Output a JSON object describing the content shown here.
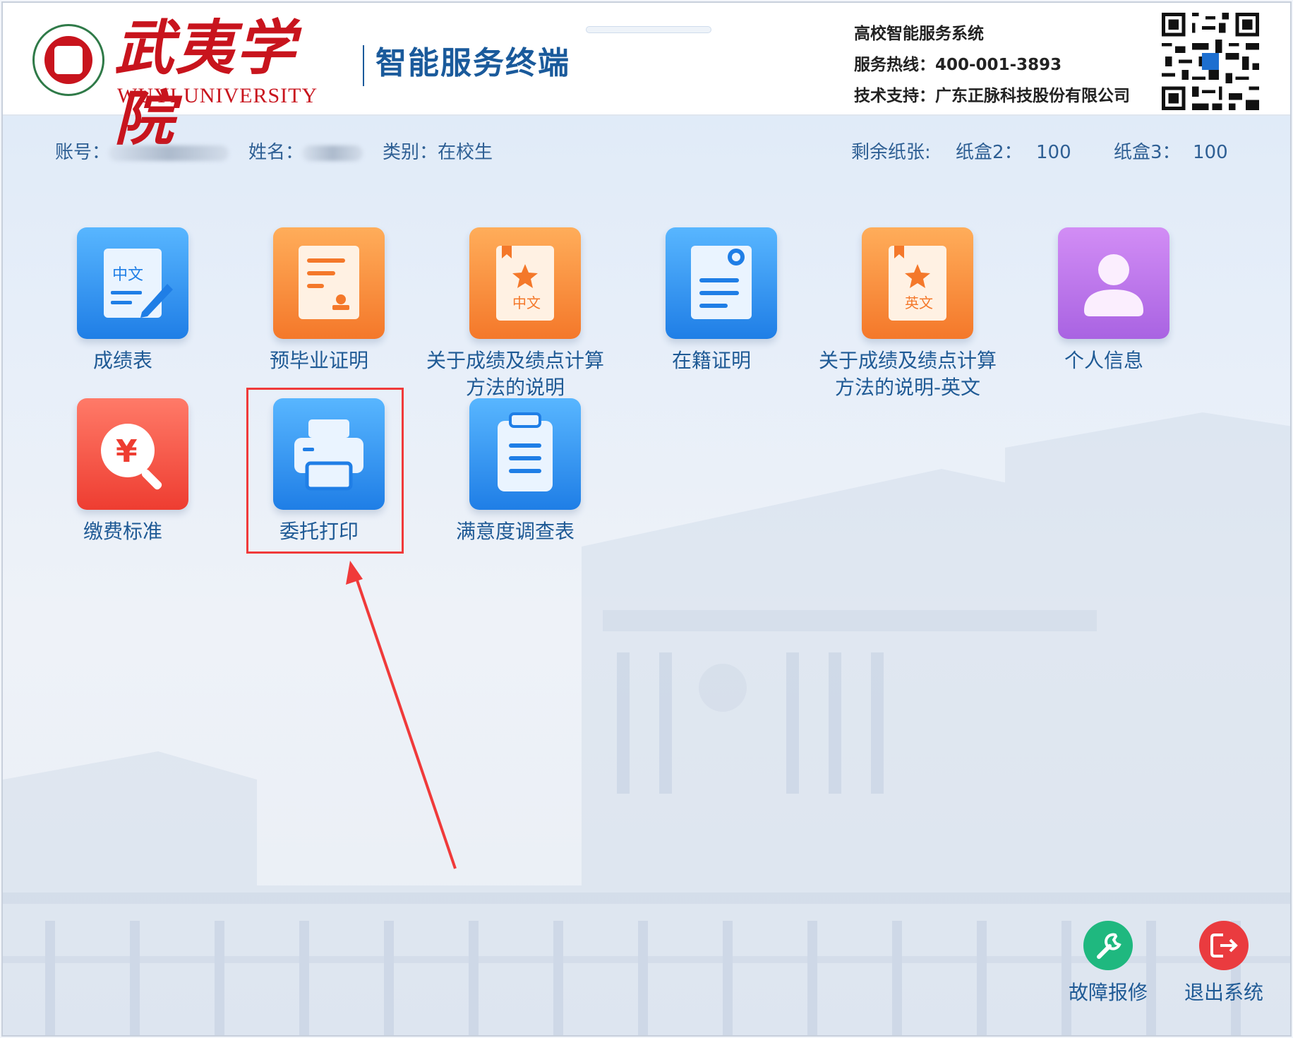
{
  "header": {
    "logo_text_cn": "武夷学院",
    "logo_text_en": "WUYI  UNIVERSITY",
    "terminal_title": "智能服务终端",
    "system_name": "高校智能服务系统",
    "hotline": "服务热线：400-001-3893",
    "support": "技术支持：广东正脉科技股份有限公司"
  },
  "user": {
    "account_label": "账号：",
    "name_label": "姓名：",
    "category_label": "类别：在校生"
  },
  "paper": {
    "remaining_label": "剩余纸张:",
    "tray2_label": "纸盒2：",
    "tray2_value": "100",
    "tray3_label": "纸盒3：",
    "tray3_value": "100"
  },
  "tiles": [
    {
      "label": "成绩表",
      "icon": "transcript-icon",
      "color": "blue"
    },
    {
      "label": "预毕业证明",
      "icon": "certificate-icon",
      "color": "orange"
    },
    {
      "label": "关于成绩及绩点计算方法的说明",
      "icon": "gpa-cn-icon",
      "color": "orange"
    },
    {
      "label": "在籍证明",
      "icon": "enrollment-icon",
      "color": "blue"
    },
    {
      "label": "关于成绩及绩点计算方法的说明-英文",
      "icon": "gpa-en-icon",
      "color": "orange"
    },
    {
      "label": "个人信息",
      "icon": "user-icon",
      "color": "purple"
    },
    {
      "label": "缴费标准",
      "icon": "fee-search-icon",
      "color": "red"
    },
    {
      "label": "委托打印",
      "icon": "printer-icon",
      "color": "blue"
    },
    {
      "label": "满意度调查表",
      "icon": "clipboard-icon",
      "color": "blue"
    }
  ],
  "icon_text": {
    "transcript": "中文",
    "gpa_cn": "中文",
    "gpa_en": "英文"
  },
  "actions": {
    "repair": "故障报修",
    "logout": "退出系统"
  }
}
